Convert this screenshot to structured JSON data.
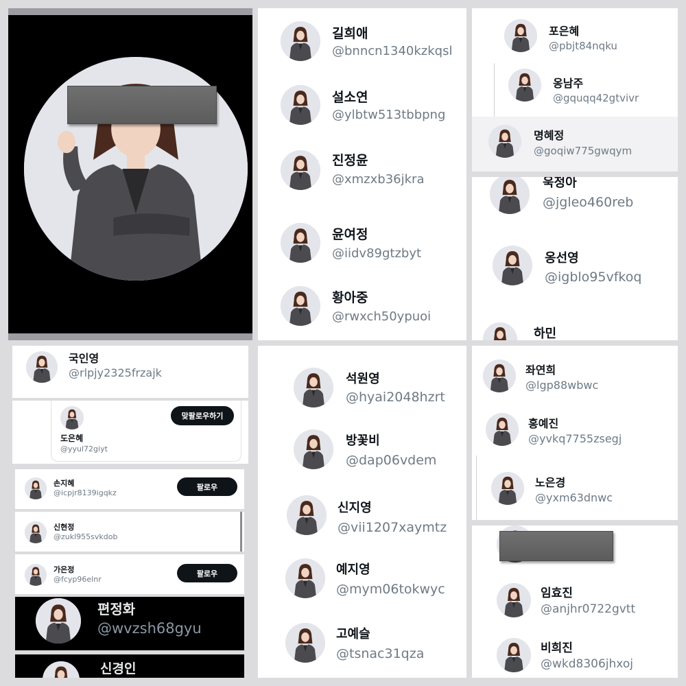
{
  "profiles": {
    "p2": [
      {
        "name": "길희애",
        "handle": "@bnncn1340kzkqsl"
      },
      {
        "name": "설소연",
        "handle": "@ylbtw513tbbpng"
      },
      {
        "name": "진정윤",
        "handle": "@xmzxb36jkra"
      },
      {
        "name": "윤여정",
        "handle": "@iidv89gtzbyt"
      },
      {
        "name": "황아중",
        "handle": "@rwxch50ypuoi"
      }
    ],
    "p3": [
      {
        "name": "포은혜",
        "handle": "@pbjt84nqku"
      },
      {
        "name": "옹남주",
        "handle": "@gquqq42gtvivr"
      },
      {
        "name": "명혜정",
        "handle": "@goqiw775gwqym"
      }
    ],
    "p4": [
      {
        "name": "욱정아",
        "handle": "@jgleo460reb"
      },
      {
        "name": "옹선영",
        "handle": "@igblo95vfkoq"
      },
      {
        "name": "하민",
        "handle": ""
      }
    ],
    "p5": [
      {
        "name": "국인영",
        "handle": "@rlpjy2325frzajk"
      },
      {
        "name": "도은혜",
        "handle": "@yyul72giyt",
        "button": "맞팔로우하기"
      },
      {
        "name": "손지혜",
        "handle": "@icpjr8139igqkz",
        "button": "팔로우"
      },
      {
        "name": "신현정",
        "handle": "@zukl955svkdob"
      },
      {
        "name": "가은정",
        "handle": "@fcyp96elnr",
        "button": "팔로우"
      },
      {
        "name": "편정화",
        "handle": "@wvzsh68gyu"
      },
      {
        "name": "신경인",
        "handle": ""
      }
    ],
    "p6": [
      {
        "name": "석원영",
        "handle": "@hyai2048hzrt"
      },
      {
        "name": "방꽃비",
        "handle": "@dap06vdem"
      },
      {
        "name": "신지영",
        "handle": "@vii1207xaymtz"
      },
      {
        "name": "예지영",
        "handle": "@mym06tokwyc"
      },
      {
        "name": "고예슬",
        "handle": "@tsnac31qza"
      }
    ],
    "p7": [
      {
        "name": "좌연희",
        "handle": "@lgp88wbwc"
      },
      {
        "name": "홍예진",
        "handle": "@yvkq7755zsegj"
      },
      {
        "name": "노은경",
        "handle": "@yxm63dnwc"
      }
    ],
    "p8": [
      {
        "name": "임효진",
        "handle": "@anjhr0722gvtt"
      },
      {
        "name": "비희진",
        "handle": "@wkd8306jhxoj"
      }
    ]
  },
  "icons": {
    "avatar": "woman-in-gray-blazer-avatar",
    "redaction": "gray-redaction-bar"
  },
  "colors": {
    "background": "#dcdcde",
    "panel": "#ffffff",
    "handle": "#6e7a85",
    "button": "#0f1419",
    "black_panel": "#000000"
  }
}
